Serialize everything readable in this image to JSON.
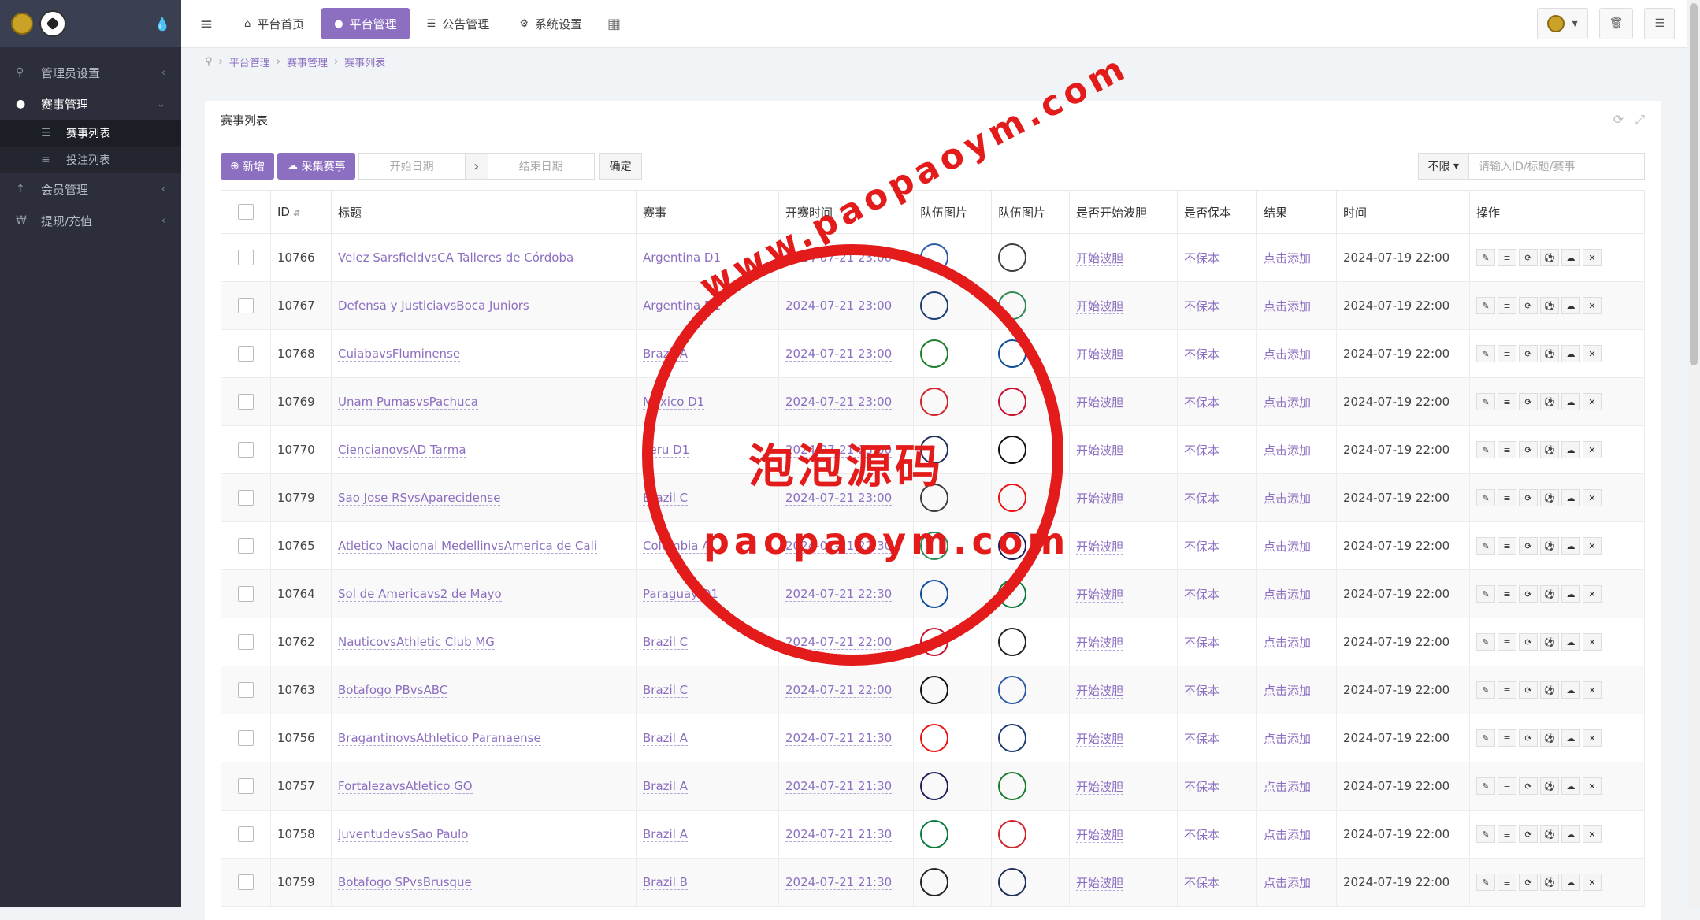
{
  "sidebar": {
    "items": [
      {
        "label": "管理员设置",
        "icon": "user-key-icon"
      },
      {
        "label": "赛事管理",
        "icon": "users-icon",
        "active": true
      },
      {
        "label": "会员管理",
        "icon": "user-up-icon"
      },
      {
        "label": "提现/充值",
        "icon": "won-icon"
      }
    ],
    "sub_items": [
      {
        "label": "赛事列表",
        "current": true
      },
      {
        "label": "投注列表"
      }
    ]
  },
  "topbar": {
    "tabs": [
      {
        "label": "平台首页",
        "icon": "home-icon"
      },
      {
        "label": "平台管理",
        "icon": "user-icon",
        "active": true
      },
      {
        "label": "公告管理",
        "icon": "list-icon"
      },
      {
        "label": "系统设置",
        "icon": "gear-icon"
      }
    ]
  },
  "breadcrumb": [
    "平台管理",
    "赛事管理",
    "赛事列表"
  ],
  "panel": {
    "title": "赛事列表",
    "add_label": "新增",
    "collect_label": "采集赛事",
    "start_placeholder": "开始日期",
    "end_placeholder": "结束日期",
    "confirm_label": "确定",
    "filter_label": "不限",
    "search_placeholder": "请输入ID/标题/赛事"
  },
  "table": {
    "headers": [
      "ID",
      "标题",
      "赛事",
      "开赛时间",
      "队伍图片",
      "队伍图片",
      "是否开始波胆",
      "是否保本",
      "结果",
      "时间",
      "操作"
    ],
    "rows": [
      {
        "id": "10766",
        "title": "Velez SarsfieldvsCA Talleres de Córdoba",
        "league": "Argentina D1",
        "start": "2024-07-21 23:00",
        "wave": "开始波胆",
        "guarantee": "不保本",
        "result": "点击添加",
        "time": "2024-07-19 22:00"
      },
      {
        "id": "10767",
        "title": "Defensa y JusticiavsBoca Juniors",
        "league": "Argentina D1",
        "start": "2024-07-21 23:00",
        "wave": "开始波胆",
        "guarantee": "不保本",
        "result": "点击添加",
        "time": "2024-07-19 22:00"
      },
      {
        "id": "10768",
        "title": "CuiabavsFluminense",
        "league": "Brazil A",
        "start": "2024-07-21 23:00",
        "wave": "开始波胆",
        "guarantee": "不保本",
        "result": "点击添加",
        "time": "2024-07-19 22:00"
      },
      {
        "id": "10769",
        "title": "Unam PumasvsPachuca",
        "league": "Mexico D1",
        "start": "2024-07-21 23:00",
        "wave": "开始波胆",
        "guarantee": "不保本",
        "result": "点击添加",
        "time": "2024-07-19 22:00"
      },
      {
        "id": "10770",
        "title": "CiencianovsAD Tarma",
        "league": "Peru D1",
        "start": "2024-07-21 23:00",
        "wave": "开始波胆",
        "guarantee": "不保本",
        "result": "点击添加",
        "time": "2024-07-19 22:00"
      },
      {
        "id": "10779",
        "title": "Sao Jose RSvsAparecidense",
        "league": "Brazil C",
        "start": "2024-07-21 23:00",
        "wave": "开始波胆",
        "guarantee": "不保本",
        "result": "点击添加",
        "time": "2024-07-19 22:00"
      },
      {
        "id": "10765",
        "title": "Atletico Nacional MedellinvsAmerica de Cali",
        "league": "Colombia A",
        "start": "2024-07-21 22:30",
        "wave": "开始波胆",
        "guarantee": "不保本",
        "result": "点击添加",
        "time": "2024-07-19 22:00"
      },
      {
        "id": "10764",
        "title": "Sol de Americavs2 de Mayo",
        "league": "Paraguay D1",
        "start": "2024-07-21 22:30",
        "wave": "开始波胆",
        "guarantee": "不保本",
        "result": "点击添加",
        "time": "2024-07-19 22:00"
      },
      {
        "id": "10762",
        "title": "NauticovsAthletic Club MG",
        "league": "Brazil C",
        "start": "2024-07-21 22:00",
        "wave": "开始波胆",
        "guarantee": "不保本",
        "result": "点击添加",
        "time": "2024-07-19 22:00"
      },
      {
        "id": "10763",
        "title": "Botafogo PBvsABC",
        "league": "Brazil C",
        "start": "2024-07-21 22:00",
        "wave": "开始波胆",
        "guarantee": "不保本",
        "result": "点击添加",
        "time": "2024-07-19 22:00"
      },
      {
        "id": "10756",
        "title": "BragantinovsAthletico Paranaense",
        "league": "Brazil A",
        "start": "2024-07-21 21:30",
        "wave": "开始波胆",
        "guarantee": "不保本",
        "result": "点击添加",
        "time": "2024-07-19 22:00"
      },
      {
        "id": "10757",
        "title": "FortalezavsAtletico GO",
        "league": "Brazil A",
        "start": "2024-07-21 21:30",
        "wave": "开始波胆",
        "guarantee": "不保本",
        "result": "点击添加",
        "time": "2024-07-19 22:00"
      },
      {
        "id": "10758",
        "title": "JuventudevsSao Paulo",
        "league": "Brazil A",
        "start": "2024-07-21 21:30",
        "wave": "开始波胆",
        "guarantee": "不保本",
        "result": "点击添加",
        "time": "2024-07-19 22:00"
      },
      {
        "id": "10759",
        "title": "Botafogo SPvsBrusque",
        "league": "Brazil B",
        "start": "2024-07-21 21:30",
        "wave": "开始波胆",
        "guarantee": "不保本",
        "result": "点击添加",
        "time": "2024-07-19 22:00"
      }
    ]
  },
  "watermark": {
    "line1": "www.paopaoym.com",
    "line2": "泡泡源码",
    "line3": "paopaoym.com",
    "color": "#e31b1b"
  },
  "colors": {
    "accent": "#8d6fc1",
    "sidebar": "#2c2f3b"
  }
}
